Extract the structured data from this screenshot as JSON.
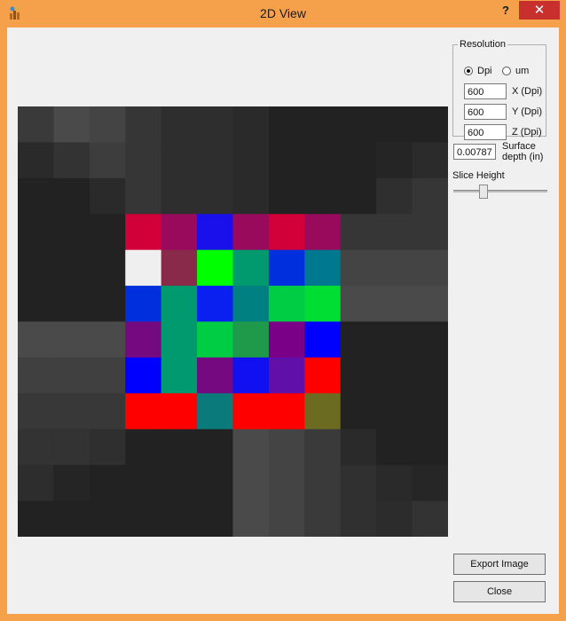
{
  "window": {
    "title": "2D View",
    "help_label": "?",
    "close_label": "✕"
  },
  "resolution": {
    "group_label": "Resolution",
    "units": [
      {
        "label": "Dpi",
        "selected": true
      },
      {
        "label": "um",
        "selected": false
      }
    ],
    "x_value": "600",
    "x_label": "X (Dpi)",
    "y_value": "600",
    "y_label": "Y (Dpi)",
    "z_value": "600",
    "z_label": "Z (Dpi)"
  },
  "surface": {
    "depth_value": "0.00787",
    "depth_label": "Surface depth (in)"
  },
  "slice": {
    "label": "Slice Height",
    "level": 0.3
  },
  "buttons": {
    "export": "Export Image",
    "close": "Close"
  },
  "image_grid": {
    "cols": 12,
    "cells": [
      [
        "#3a3a3a",
        "#4a4a4a",
        "#444444",
        "#363636",
        "#2e2e2e",
        "#2e2e2e",
        "#2a2a2a",
        "#222222",
        "#222222",
        "#222222",
        "#222222",
        "#222222"
      ],
      [
        "#2a2a2a",
        "#333333",
        "#3d3d3d",
        "#363636",
        "#2e2e2e",
        "#2e2e2e",
        "#2a2a2a",
        "#222222",
        "#222222",
        "#222222",
        "#252525",
        "#2b2b2b"
      ],
      [
        "#222222",
        "#222222",
        "#2a2a2a",
        "#363636",
        "#2e2e2e",
        "#2e2e2e",
        "#2a2a2a",
        "#222222",
        "#222222",
        "#222222",
        "#2f2f2f",
        "#363636"
      ],
      [
        "#222222",
        "#222222",
        "#222222",
        "#d10038",
        "#9a0a5c",
        "#1a10ec",
        "#9a0a5c",
        "#d10038",
        "#9a0a5c",
        "#363636",
        "#363636",
        "#363636"
      ],
      [
        "#222222",
        "#222222",
        "#222222",
        "#efefef",
        "#8a2a4a",
        "#00ff00",
        "#009a6e",
        "#0030de",
        "#007890",
        "#444444",
        "#444444",
        "#444444"
      ],
      [
        "#222222",
        "#222222",
        "#222222",
        "#0030de",
        "#009a6e",
        "#0a20f0",
        "#008080",
        "#00cc44",
        "#00dd33",
        "#4a4a4a",
        "#4a4a4a",
        "#4a4a4a"
      ],
      [
        "#4a4a4a",
        "#4a4a4a",
        "#4a4a4a",
        "#750a80",
        "#009a6e",
        "#00cc44",
        "#1e9a4a",
        "#7a0088",
        "#0000ff",
        "#222222",
        "#222222",
        "#222222"
      ],
      [
        "#404040",
        "#404040",
        "#404040",
        "#0000ff",
        "#009a6e",
        "#750a80",
        "#1010f0",
        "#6010a8",
        "#ff0000",
        "#222222",
        "#222222",
        "#222222"
      ],
      [
        "#383838",
        "#383838",
        "#383838",
        "#ff0000",
        "#ff0000",
        "#0a7a7a",
        "#ff0000",
        "#ff0000",
        "#6b6b22",
        "#222222",
        "#222222",
        "#222222"
      ],
      [
        "#333333",
        "#333333",
        "#2f2f2f",
        "#222222",
        "#222222",
        "#222222",
        "#4a4a4a",
        "#444444",
        "#3a3a3a",
        "#2a2a2a",
        "#222222",
        "#222222"
      ],
      [
        "#2d2d2d",
        "#252525",
        "#222222",
        "#222222",
        "#222222",
        "#222222",
        "#4a4a4a",
        "#444444",
        "#3a3a3a",
        "#303030",
        "#2a2a2a",
        "#262626"
      ],
      [
        "#222222",
        "#222222",
        "#222222",
        "#222222",
        "#222222",
        "#222222",
        "#4a4a4a",
        "#444444",
        "#3a3a3a",
        "#303030",
        "#2c2c2c",
        "#333333"
      ]
    ]
  }
}
